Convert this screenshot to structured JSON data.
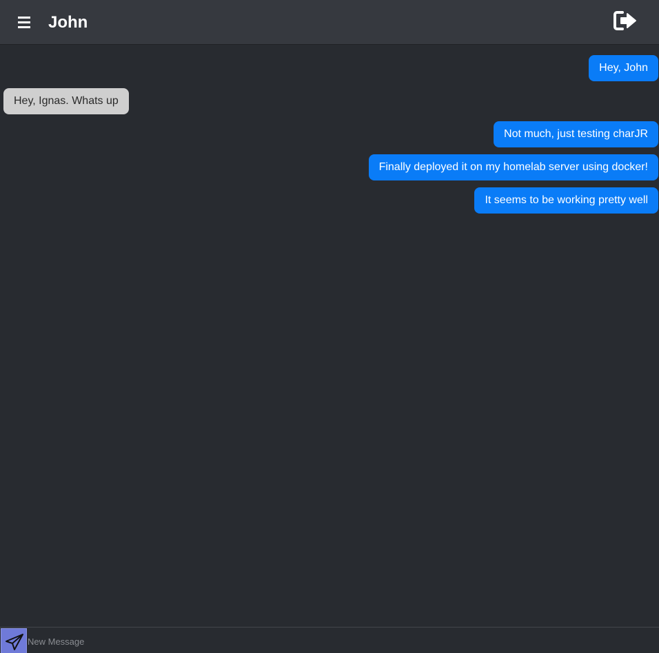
{
  "header": {
    "menu_icon": "hamburger-menu-icon",
    "title": "John",
    "logout_icon": "sign-out-icon"
  },
  "messages": [
    {
      "direction": "sent",
      "text": "Hey, John"
    },
    {
      "direction": "received",
      "text": "Hey, Ignas. Whats up"
    },
    {
      "direction": "sent",
      "text": "Not much, just testing charJR"
    },
    {
      "direction": "sent",
      "text": "Finally deployed it on my homelab server using docker!"
    },
    {
      "direction": "sent",
      "text": "It seems to be working pretty well"
    }
  ],
  "composer": {
    "send_icon": "paper-plane-icon",
    "placeholder": "New Message",
    "value": ""
  },
  "colors": {
    "background": "#282b30",
    "header": "#36393f",
    "sent_bubble": "#0a7cf7",
    "received_bubble": "#cfcfcf",
    "send_button": "#6f7ad8"
  }
}
